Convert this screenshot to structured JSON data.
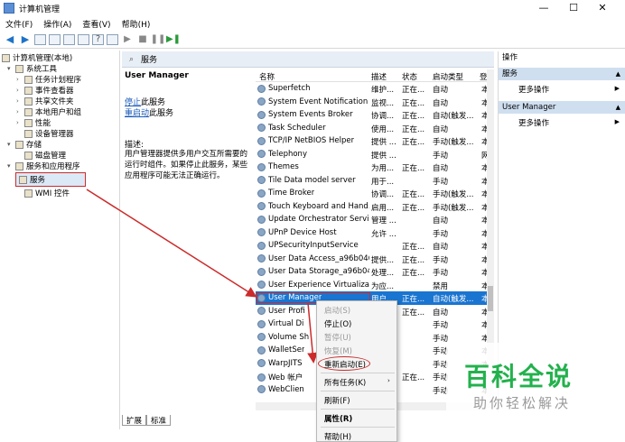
{
  "window": {
    "title": "计算机管理",
    "controls": [
      "—",
      "☐",
      "✕"
    ]
  },
  "menu": [
    "文件(F)",
    "操作(A)",
    "查看(V)",
    "帮助(H)"
  ],
  "tree": {
    "root": "计算机管理(本地)",
    "system_tools": "系统工具",
    "task_scheduler": "任务计划程序",
    "event_viewer": "事件查看器",
    "shared_folders": "共享文件夹",
    "local_users": "本地用户和组",
    "performance": "性能",
    "device_manager": "设备管理器",
    "storage": "存储",
    "disk_management": "磁盘管理",
    "services_apps": "服务和应用程序",
    "services": "服务",
    "wmi": "WMI 控件"
  },
  "center_header": "服务",
  "detail": {
    "service": "User Manager",
    "stop_link": "停止",
    "stop_suffix": "此服务",
    "restart_link": "重启动",
    "restart_suffix": "此服务",
    "desc_label": "描述:",
    "description": "用户管理器提供多用户交互所需要的运行时组件。如果停止此服务，某些应用程序可能无法正确运行。"
  },
  "columns": [
    "名称",
    "描述",
    "状态",
    "启动类型",
    "登"
  ],
  "services": [
    [
      "Superfetch",
      "维护...",
      "正在...",
      "自动",
      "本"
    ],
    [
      "System Event Notification ...",
      "监视...",
      "正在...",
      "自动",
      "本"
    ],
    [
      "System Events Broker",
      "协调...",
      "正在...",
      "自动(触发...",
      "本"
    ],
    [
      "Task Scheduler",
      "使用...",
      "正在...",
      "自动",
      "本"
    ],
    [
      "TCP/IP NetBIOS Helper",
      "提供 ...",
      "正在...",
      "手动(触发...",
      "本"
    ],
    [
      "Telephony",
      "提供 ...",
      "",
      "手动",
      "网"
    ],
    [
      "Themes",
      "为用...",
      "正在...",
      "自动",
      "本"
    ],
    [
      "Tile Data model server",
      "用于...",
      "",
      "手动",
      "本"
    ],
    [
      "Time Broker",
      "协调...",
      "正在...",
      "手动(触发...",
      "本"
    ],
    [
      "Touch Keyboard and Hand...",
      "启用...",
      "正在...",
      "手动(触发...",
      "本"
    ],
    [
      "Update Orchestrator Service",
      "管理 ...",
      "",
      "自动",
      "本"
    ],
    [
      "UPnP Device Host",
      "允许 ...",
      "",
      "手动",
      "本"
    ],
    [
      "UPSecurityInputService",
      "",
      "正在...",
      "自动",
      "本"
    ],
    [
      "User Data Access_a96b046",
      "提供...",
      "正在...",
      "手动",
      "本"
    ],
    [
      "User Data Storage_a96b046",
      "处理...",
      "正在...",
      "手动",
      "本"
    ],
    [
      "User Experience Virtualizat...",
      "为应...",
      "",
      "禁用",
      "本"
    ],
    [
      "User Manager",
      "用户...",
      "正在...",
      "自动(触发...",
      "本"
    ],
    [
      "User Profi",
      "",
      "正在...",
      "自动",
      "本"
    ],
    [
      "Virtual Di",
      "",
      "",
      "手动",
      "本"
    ],
    [
      "Volume Sh",
      "",
      "",
      "手动",
      "本"
    ],
    [
      "WalletSer",
      "",
      "",
      "手动",
      "本"
    ],
    [
      "WarpJITS",
      "",
      "",
      "手动",
      "本"
    ],
    [
      "Web 帐户",
      "",
      "正在...",
      "手动",
      "本"
    ],
    [
      "WebClien",
      "",
      "",
      "手动",
      "本"
    ]
  ],
  "actions": {
    "title": "操作",
    "group1": "服务",
    "more1": "更多操作",
    "group2": "User Manager",
    "more2": "更多操作"
  },
  "context_menu": {
    "start": "启动(S)",
    "stop": "停止(O)",
    "pause": "暂停(U)",
    "resume": "恢复(M)",
    "restart": "重新启动(E)",
    "all_tasks": "所有任务(K)",
    "refresh": "刷新(F)",
    "properties": "属性(R)",
    "help": "帮助(H)"
  },
  "tabs": [
    "扩展",
    "标准"
  ],
  "watermark": {
    "brand": "百科全说",
    "slogan": "助你轻松解决"
  },
  "colors": {
    "highlight": "#1a75d0",
    "annotation_red": "#cc2b2b",
    "watermark_green": "#23b14d"
  }
}
